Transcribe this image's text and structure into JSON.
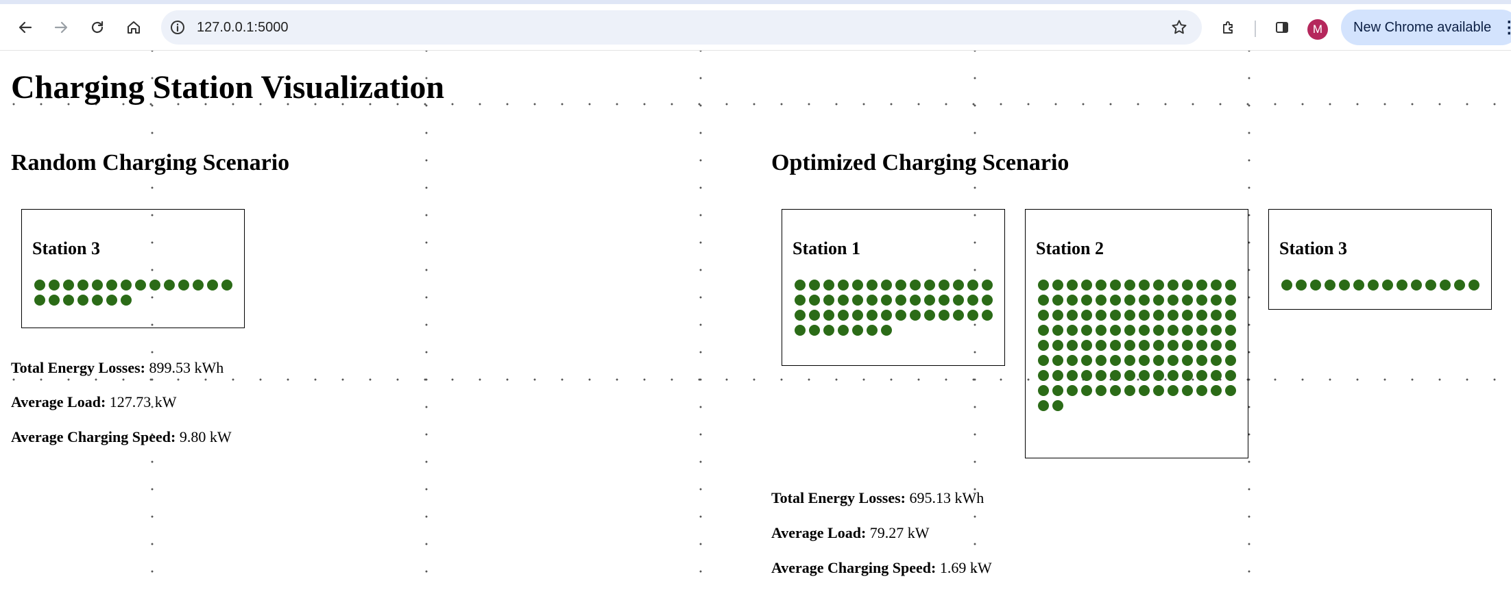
{
  "browser": {
    "url": "127.0.0.1:5000",
    "update_label": "New Chrome available",
    "profile_initial": "M"
  },
  "page": {
    "title": "Charging Station Visualization"
  },
  "random": {
    "title": "Random Charging Scenario",
    "stations": [
      {
        "name": "Station 3",
        "vehicles": 21
      }
    ],
    "metrics": [
      {
        "label": "Total Energy Losses:",
        "value": "899.53 kWh"
      },
      {
        "label": "Average Load:",
        "value": "127.73 kW"
      },
      {
        "label": "Average Charging Speed:",
        "value": "9.80 kW"
      }
    ]
  },
  "optimized": {
    "title": "Optimized Charging Scenario",
    "stations": [
      {
        "name": "Station 1",
        "vehicles": 49
      },
      {
        "name": "Station 2",
        "vehicles": 114
      },
      {
        "name": "Station 3",
        "vehicles": 14
      }
    ],
    "metrics": [
      {
        "label": "Total Energy Losses:",
        "value": "695.13 kWh"
      },
      {
        "label": "Average Load:",
        "value": "79.27 kW"
      },
      {
        "label": "Average Charging Speed:",
        "value": "1.69 kW"
      }
    ]
  },
  "colors": {
    "vehicle": "#2b6b17"
  }
}
